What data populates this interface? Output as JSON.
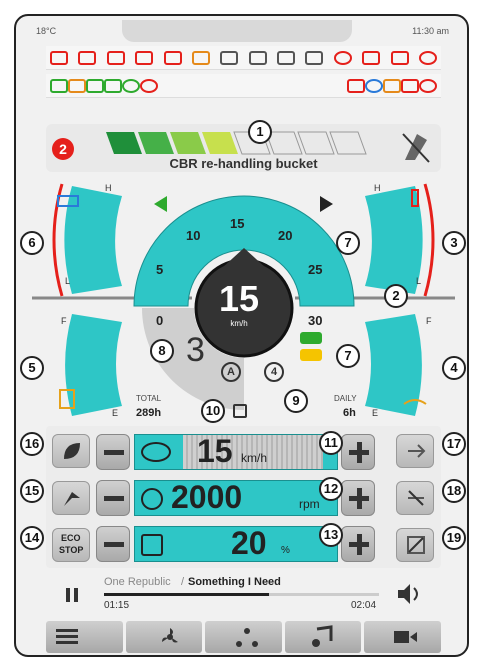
{
  "status": {
    "temperature": "18°C",
    "time": "11:30 am"
  },
  "tool": {
    "number": "2",
    "name": "CBR re-handling bucket"
  },
  "gauge_left_top": {
    "high": "H",
    "low": "L"
  },
  "gauge_right_top": {
    "high": "H",
    "low": "L"
  },
  "gauge_left_bottom": {
    "full": "F",
    "empty": "E"
  },
  "gauge_right_bottom": {
    "full": "F",
    "empty": "E"
  },
  "speedometer": {
    "ticks": [
      "0",
      "5",
      "10",
      "15",
      "20",
      "25",
      "30"
    ],
    "speed": "15",
    "unit": "km/h"
  },
  "gear": {
    "value": "3",
    "mode": "A",
    "drive": "4"
  },
  "hours": {
    "total_label": "TOTAL",
    "total": "289h",
    "daily_label": "DAILY",
    "daily": "6h"
  },
  "controls": {
    "speed_value": "15",
    "speed_unit": "km/h",
    "rpm_value": "2000",
    "rpm_unit": "rpm",
    "fan_value": "20",
    "fan_unit": "%",
    "eco_label_1": "ECO",
    "eco_label_2": "STOP"
  },
  "media": {
    "artist": "One Republic",
    "separator": " / ",
    "track": "Something I Need",
    "elapsed": "01:15",
    "duration": "02:04",
    "progress": 0.6
  },
  "callouts": [
    "1",
    "2",
    "3",
    "4",
    "5",
    "6",
    "7",
    "7",
    "8",
    "9",
    "10",
    "11",
    "12",
    "13",
    "14",
    "15",
    "16",
    "17",
    "18",
    "19"
  ],
  "colors": {
    "accent": "#2ec6c6",
    "warning": "#e5201b",
    "indicator_green": "#2eaa2e"
  }
}
